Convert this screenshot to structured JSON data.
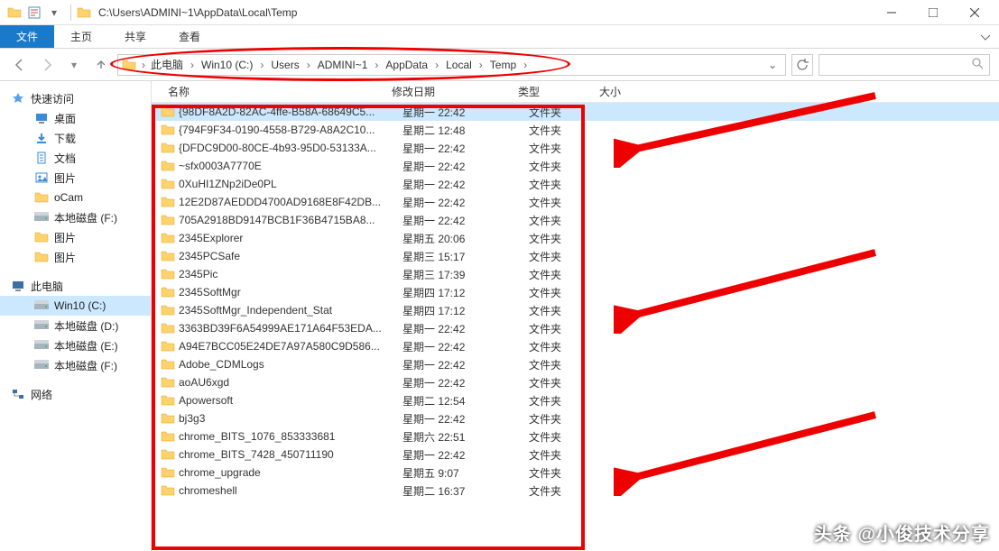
{
  "titlebar": {
    "path": "C:\\Users\\ADMINI~1\\AppData\\Local\\Temp"
  },
  "ribbon": {
    "file": "文件",
    "home": "主页",
    "share": "共享",
    "view": "查看"
  },
  "breadcrumbs": [
    "此电脑",
    "Win10 (C:)",
    "Users",
    "ADMINI~1",
    "AppData",
    "Local",
    "Temp"
  ],
  "search": {
    "placeholder": ""
  },
  "columns": {
    "name": "名称",
    "date": "修改日期",
    "type": "类型",
    "size": "大小"
  },
  "sidebar": {
    "quick": "快速访问",
    "items_quick": [
      {
        "label": "桌面",
        "icon": "desktop"
      },
      {
        "label": "下载",
        "icon": "download"
      },
      {
        "label": "文档",
        "icon": "document"
      },
      {
        "label": "图片",
        "icon": "picture"
      },
      {
        "label": "oCam",
        "icon": "folder"
      },
      {
        "label": "本地磁盘 (F:)",
        "icon": "drive"
      },
      {
        "label": "图片",
        "icon": "folder"
      },
      {
        "label": "图片",
        "icon": "folder"
      }
    ],
    "thispc": "此电脑",
    "items_pc": [
      {
        "label": "Win10 (C:)",
        "icon": "drive",
        "selected": true
      },
      {
        "label": "本地磁盘 (D:)",
        "icon": "drive"
      },
      {
        "label": "本地磁盘 (E:)",
        "icon": "drive"
      },
      {
        "label": "本地磁盘 (F:)",
        "icon": "drive"
      }
    ],
    "network": "网络"
  },
  "files": [
    {
      "name": "{98DF8A2D-82AC-4ffe-B58A-68649C5...",
      "date": "星期一 22:42",
      "type": "文件夹",
      "selected": true
    },
    {
      "name": "{794F9F34-0190-4558-B729-A8A2C10...",
      "date": "星期二 12:48",
      "type": "文件夹"
    },
    {
      "name": "{DFDC9D00-80CE-4b93-95D0-53133A...",
      "date": "星期一 22:42",
      "type": "文件夹"
    },
    {
      "name": "~sfx0003A7770E",
      "date": "星期一 22:42",
      "type": "文件夹"
    },
    {
      "name": "0XuHI1ZNp2iDe0PL",
      "date": "星期一 22:42",
      "type": "文件夹"
    },
    {
      "name": "12E2D87AEDDD4700AD9168E8F42DB...",
      "date": "星期一 22:42",
      "type": "文件夹"
    },
    {
      "name": "705A2918BD9147BCB1F36B4715BA8...",
      "date": "星期一 22:42",
      "type": "文件夹"
    },
    {
      "name": "2345Explorer",
      "date": "星期五 20:06",
      "type": "文件夹"
    },
    {
      "name": "2345PCSafe",
      "date": "星期三 15:17",
      "type": "文件夹"
    },
    {
      "name": "2345Pic",
      "date": "星期三 17:39",
      "type": "文件夹"
    },
    {
      "name": "2345SoftMgr",
      "date": "星期四 17:12",
      "type": "文件夹"
    },
    {
      "name": "2345SoftMgr_Independent_Stat",
      "date": "星期四 17:12",
      "type": "文件夹"
    },
    {
      "name": "3363BD39F6A54999AE171A64F53EDA...",
      "date": "星期一 22:42",
      "type": "文件夹"
    },
    {
      "name": "A94E7BCC05E24DE7A97A580C9D586...",
      "date": "星期一 22:42",
      "type": "文件夹"
    },
    {
      "name": "Adobe_CDMLogs",
      "date": "星期一 22:42",
      "type": "文件夹"
    },
    {
      "name": "aoAU6xgd",
      "date": "星期一 22:42",
      "type": "文件夹"
    },
    {
      "name": "Apowersoft",
      "date": "星期二 12:54",
      "type": "文件夹"
    },
    {
      "name": "bj3g3",
      "date": "星期一 22:42",
      "type": "文件夹"
    },
    {
      "name": "chrome_BITS_1076_853333681",
      "date": "星期六 22:51",
      "type": "文件夹"
    },
    {
      "name": "chrome_BITS_7428_450711190",
      "date": "星期一 22:42",
      "type": "文件夹"
    },
    {
      "name": "chrome_upgrade",
      "date": "星期五 9:07",
      "type": "文件夹"
    },
    {
      "name": "chromeshell",
      "date": "星期二 16:37",
      "type": "文件夹"
    }
  ],
  "watermark": "头条 @小俊技术分享"
}
